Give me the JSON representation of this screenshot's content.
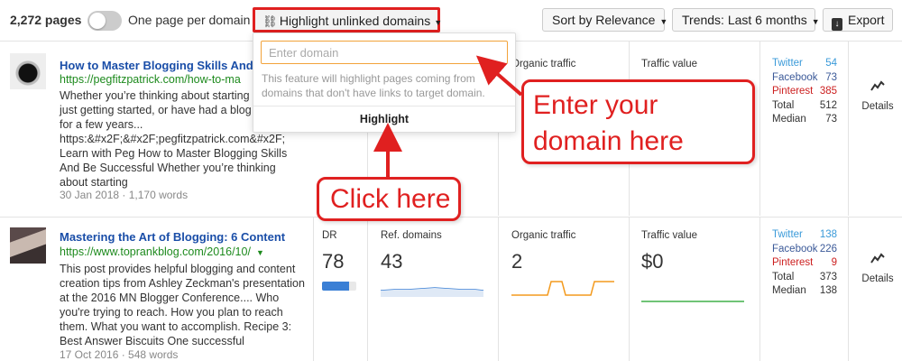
{
  "toolbar": {
    "pages_count": "2,272 pages",
    "toggle_label": "One page per domain",
    "highlight_label": "Highlight unlinked domains",
    "sort_label": "Sort by Relevance",
    "trends_label": "Trends: Last 6 months",
    "export_label": "Export"
  },
  "popup": {
    "placeholder": "Enter domain",
    "description": "This feature will highlight pages coming from domains that don't have links to target domain.",
    "button_label": "Highlight"
  },
  "callouts": {
    "domain": "Enter your domain here",
    "click": "Click here"
  },
  "metric_labels": {
    "dr": "DR",
    "ref_domains": "Ref. domains",
    "organic_traffic": "Organic traffic",
    "traffic_value": "Traffic value",
    "details": "Details"
  },
  "social_labels": {
    "twitter": "Twitter",
    "facebook": "Facebook",
    "pinterest": "Pinterest",
    "total": "Total",
    "median": "Median"
  },
  "results": [
    {
      "title": "How to Master Blogging Skills And",
      "url": "https://pegfitzpatrick.com/how-to-ma",
      "snippet": "Whether you're thinking about starting a just getting started, or have had a blog ru for a few years... https:&#x2F;&#x2F;pegfitzpatrick.com&#x2F; Learn with Peg How to Master Blogging Skills And Be Successful Whether you're thinking about starting",
      "snippet_lines": [
        "Whether you’re thinking about starting a",
        "just getting started, or have had a blog ru",
        "for a few years...",
        "https:&#x2F;&#x2F;pegfitzpatrick.com&#x2F;",
        "Learn with Peg How to Master Blogging Skills",
        "And Be Successful Whether you’re thinking",
        "about starting"
      ],
      "meta": "30 Jan 2018 · 1,170 words",
      "social": {
        "twitter": "54",
        "facebook": "73",
        "pinterest": "385",
        "total": "512",
        "median": "73"
      }
    },
    {
      "title": "Mastering the Art of Blogging: 6 Content",
      "url": "https://www.toprankblog.com/2016/10/",
      "snippet_lines": [
        "This post provides helpful blogging and content",
        "creation tips from Ashley Zeckman's presentation",
        "at the 2016 MN Blogger Conference.... Who",
        "you're trying to reach. How you plan to reach",
        "them. What you want to accomplish. Recipe 3:",
        "Best Answer Biscuits One successful"
      ],
      "meta": "17 Oct 2016 · 548 words",
      "dr": "78",
      "dr_fraction": 0.78,
      "ref_domains": "43",
      "organic_traffic": "2",
      "traffic_value": "$0",
      "social": {
        "twitter": "138",
        "facebook": "226",
        "pinterest": "9",
        "total": "373",
        "median": "138"
      }
    }
  ],
  "colors": {
    "accent_red": "#e02020",
    "link_blue": "#1a4ea8",
    "url_green": "#1d8a1d",
    "twitter": "#3a9ad9",
    "facebook": "#3b5998",
    "pinterest": "#cc1f1f",
    "dr_bar": "#3a7fd5",
    "organic_line": "#f39a1e",
    "traffic_line": "#41b04a"
  }
}
